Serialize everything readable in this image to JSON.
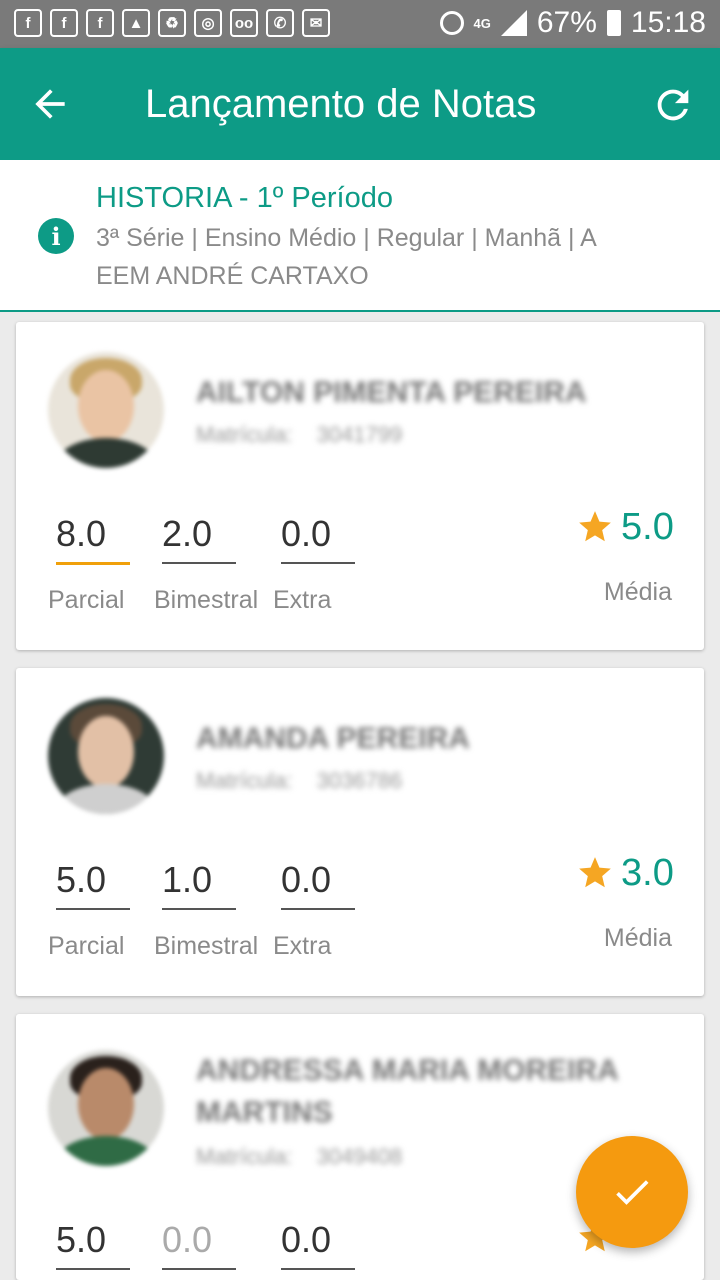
{
  "status_bar": {
    "notification_icons": [
      "f",
      "f",
      "f",
      "▲",
      "♻",
      "◎",
      "oo",
      "✆",
      "✉"
    ],
    "network": "4G",
    "battery": "67%",
    "time": "15:18"
  },
  "app_bar": {
    "title": "Lançamento de Notas"
  },
  "class_info": {
    "subject": "HISTORIA - 1º Período",
    "details": "3ª Série | Ensino Médio | Regular | Manhã | A",
    "school": "EEM ANDRÉ CARTAXO"
  },
  "grade_labels": {
    "partial": "Parcial",
    "bimonthly": "Bimestral",
    "extra": "Extra",
    "average": "Média"
  },
  "students": [
    {
      "name": "AILTON PIMENTA PEREIRA",
      "registration_label": "Matrícula:",
      "registration": "3041799",
      "partial": "8.0",
      "bimonthly": "2.0",
      "extra": "0.0",
      "average": "5.0"
    },
    {
      "name": "AMANDA PEREIRA",
      "registration_label": "Matrícula:",
      "registration": "3036786",
      "partial": "5.0",
      "bimonthly": "1.0",
      "extra": "0.0",
      "average": "3.0"
    },
    {
      "name_line1": "ANDRESSA MARIA MOREIRA",
      "name_line2": "MARTINS",
      "registration_label": "Matrícula:",
      "registration": "3049408",
      "partial": "5.0",
      "bimonthly": "0.0",
      "extra": "0.0"
    }
  ],
  "colors": {
    "primary": "#0d9b86",
    "accent": "#f59a0f",
    "star": "#f5a623",
    "status_bar": "#7a7a7a"
  }
}
